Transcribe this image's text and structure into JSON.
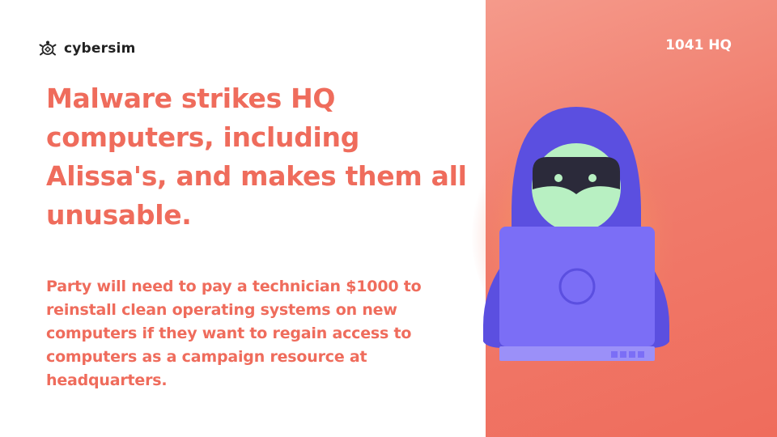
{
  "brand": {
    "name": "cybersim",
    "icon": "turtle-logo-icon"
  },
  "slide": {
    "headline": "Malware strikes HQ computers, including Alissa's, and makes them all unusable.",
    "body": "Party will need to pay a technician $1000 to reinstall clean operating systems on new computers if they want to regain access to computers as a campaign resource at headquarters.",
    "location_label": "1041 HQ"
  },
  "illustration": {
    "icon": "hooded-hacker-laptop-icon"
  },
  "colors": {
    "accent": "#ef6c5c",
    "panel": "#f07b6b",
    "hood": "#5b4fe0",
    "laptop": "#7b6ef6",
    "face": "#b8f0c2"
  }
}
